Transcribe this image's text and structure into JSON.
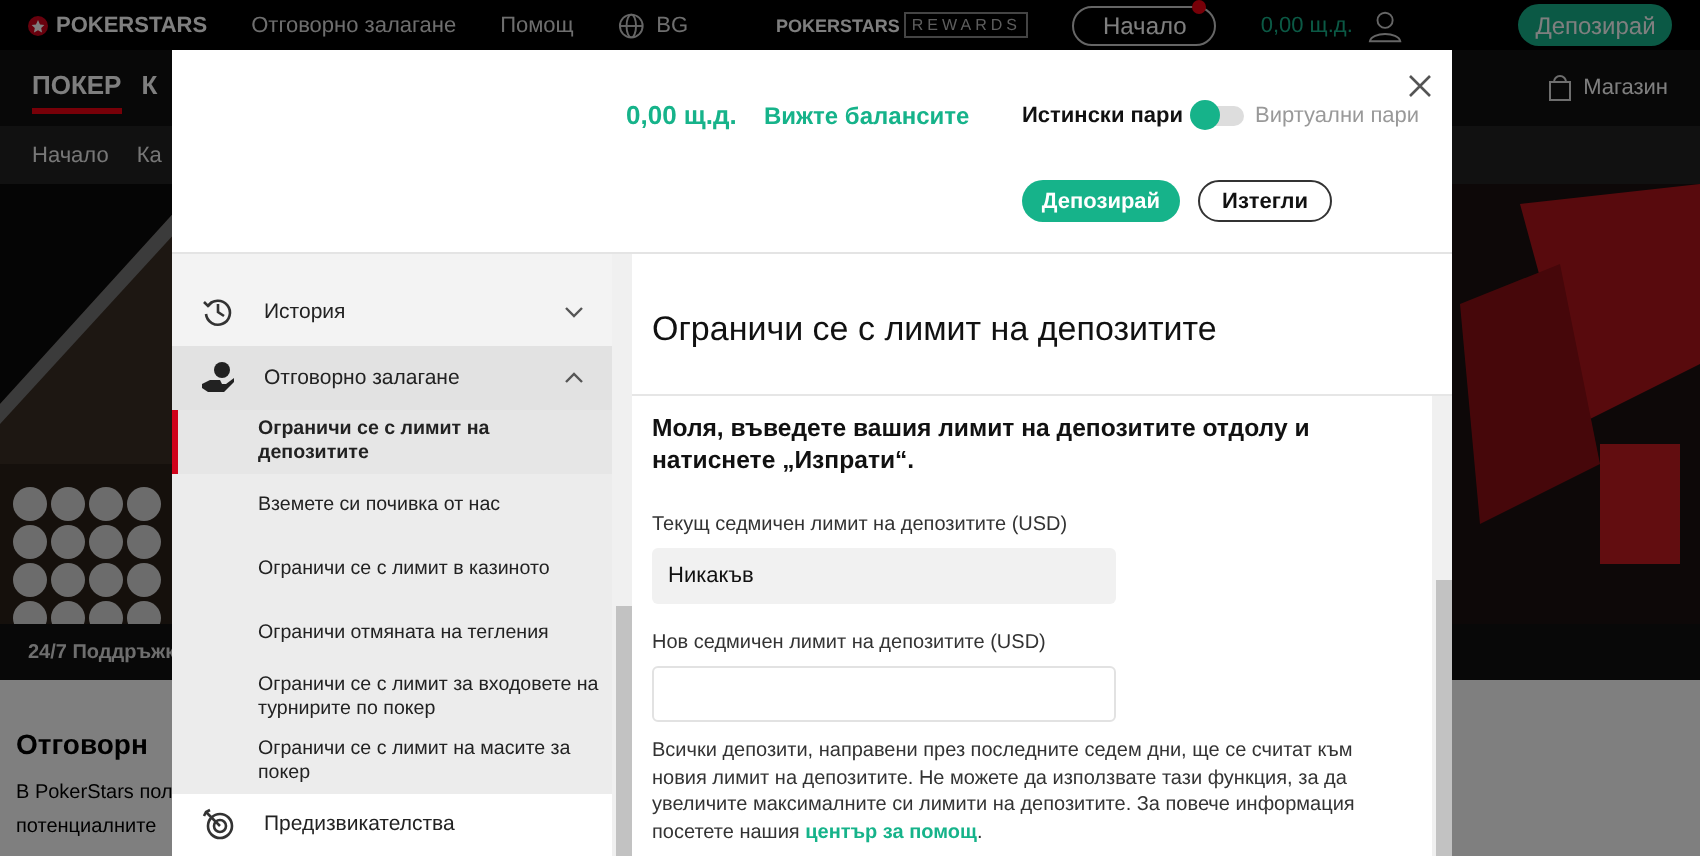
{
  "topbar": {
    "brand": "POKERSTARS",
    "links": [
      "Отговорно залагане",
      "Помощ"
    ],
    "language": "BG",
    "rewards_brand": "POKERSTARS",
    "rewards_label": "REWARDS",
    "home_button": "Начало",
    "balance": "0,00 щ.д.",
    "deposit_button": "Депозирай"
  },
  "nav": {
    "items": [
      {
        "label": "ПОКЕР",
        "selected": true
      },
      {
        "label": "К",
        "selected": false
      }
    ],
    "shop": "Магазин"
  },
  "subnav": [
    "Начало",
    "Ка"
  ],
  "support_strip": "24/7 Поддръжк",
  "page_heading": "Отговорн",
  "page_text": [
    "В PokerStars пол",
    "потенциалните"
  ],
  "modal": {
    "balance": "0,00 щ.д.",
    "balances_link": "Вижте балансите",
    "money_modes": [
      {
        "label": "Истински пари",
        "selected": true
      },
      {
        "label": "Виртуални пари",
        "selected": false
      }
    ],
    "deposit_button": "Депозирай",
    "withdraw_button": "Изтегли",
    "sidebar": [
      {
        "kind": "history",
        "label": "История",
        "expanded": false
      },
      {
        "kind": "responsible",
        "label": "Отговорно залагане",
        "expanded": true,
        "children": [
          {
            "label": "Ограничи се с лимит на депозитите",
            "selected": true
          },
          {
            "label": "Вземете си почивка от нас",
            "selected": false
          },
          {
            "label": "Ограничи се с лимит в казиното",
            "selected": false
          },
          {
            "label": "Ограничи отмяната на тегления",
            "selected": false
          },
          {
            "label": "Ограничи се с лимит за входовете на турнирите по покер",
            "selected": false
          },
          {
            "label": "Ограничи се с лимит на масите за покер",
            "selected": false
          }
        ]
      },
      {
        "kind": "challenges",
        "label": "Предизвикателства"
      }
    ],
    "title": "Ограничи се с лимит на депозитите",
    "instruction": "Моля, въведете вашия лимит на депозитите отдолу и натиснете „Изпрати“.",
    "current_label": "Текущ седмичен лимит на депозитите (USD)",
    "current_value": "Никакъв",
    "new_label": "Нов седмичен лимит на депозитите (USD)",
    "note": "Всички депозити, направени през последните седем дни, ще се считат към новия лимит на депозитите. Не можете да използвате тази функция, за да увеличите максималните си лимити на депозитите. За повече информация посетете нашия ",
    "note_link": "център за помощ",
    "note_end": "."
  }
}
